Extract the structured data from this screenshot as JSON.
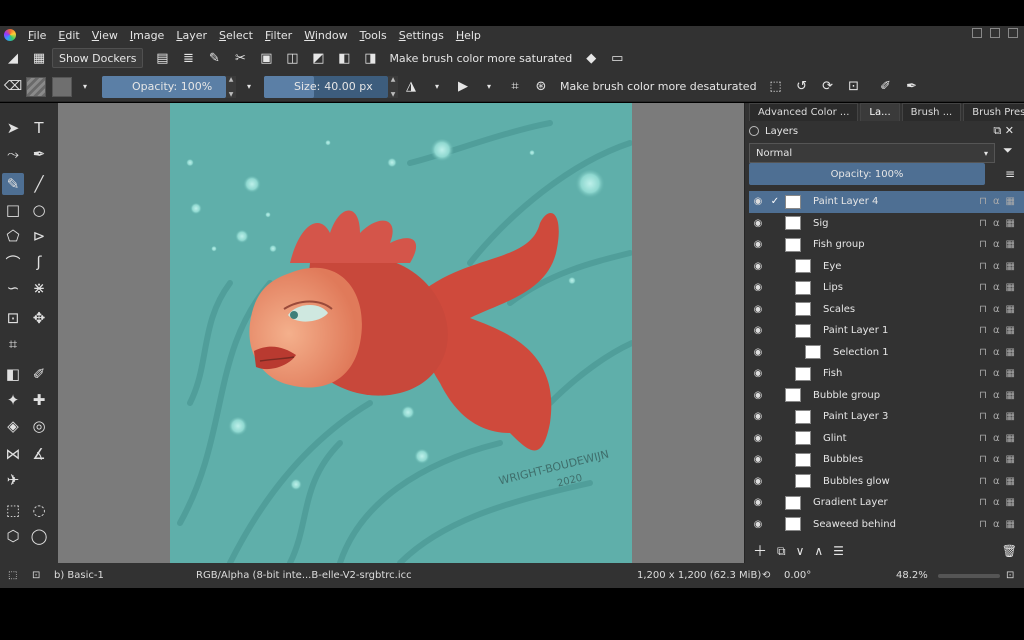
{
  "menu": [
    "File",
    "Edit",
    "View",
    "Image",
    "Layer",
    "Select",
    "Filter",
    "Window",
    "Tools",
    "Settings",
    "Help"
  ],
  "toolbar1": {
    "show_dockers": "Show Dockers",
    "saturated_label": "Make brush color more saturated"
  },
  "toolbar2": {
    "opacity": "Opacity: 100%",
    "size_label": "Size:",
    "size_value": "40.00 px",
    "desaturated_label": "Make brush color more desaturated"
  },
  "dock": {
    "tabs": [
      "Advanced Color ...",
      "La...",
      "Brush ...",
      "Brush Preset ..."
    ],
    "title": "Layers",
    "blend_mode": "Normal",
    "opacity": "Opacity:  100%",
    "layers": [
      {
        "name": "Paint Layer 4",
        "selected": true,
        "indent": 0
      },
      {
        "name": "Sig",
        "indent": 0
      },
      {
        "name": "Fish group",
        "indent": 0
      },
      {
        "name": "Eye",
        "indent": 1
      },
      {
        "name": "Lips",
        "indent": 1
      },
      {
        "name": "Scales",
        "indent": 1
      },
      {
        "name": "Paint Layer 1",
        "indent": 1
      },
      {
        "name": "Selection 1",
        "indent": 2
      },
      {
        "name": "Fish",
        "indent": 1
      },
      {
        "name": "Bubble group",
        "indent": 0
      },
      {
        "name": "Paint Layer 3",
        "indent": 1
      },
      {
        "name": "Glint",
        "indent": 1
      },
      {
        "name": "Bubbles",
        "indent": 1
      },
      {
        "name": "Bubbles glow",
        "indent": 1
      },
      {
        "name": "Gradient Layer",
        "indent": 0
      },
      {
        "name": "Seaweed  behind",
        "indent": 0
      }
    ]
  },
  "artwork": {
    "signature": "WRIGHT-BOUDEWIJN",
    "signature_year": "2020"
  },
  "status": {
    "preset": "b) Basic-1",
    "colorspace": "RGB/Alpha (8-bit inte...B-elle-V2-srgbtrc.icc",
    "dimensions": "1,200 x 1,200 (62.3 MiB)",
    "rotation": "0.00°",
    "zoom": "48.2%"
  },
  "colors": {
    "panel": "#323232",
    "accent": "#4e6f93",
    "canvas_bg": "#5fafaa"
  }
}
